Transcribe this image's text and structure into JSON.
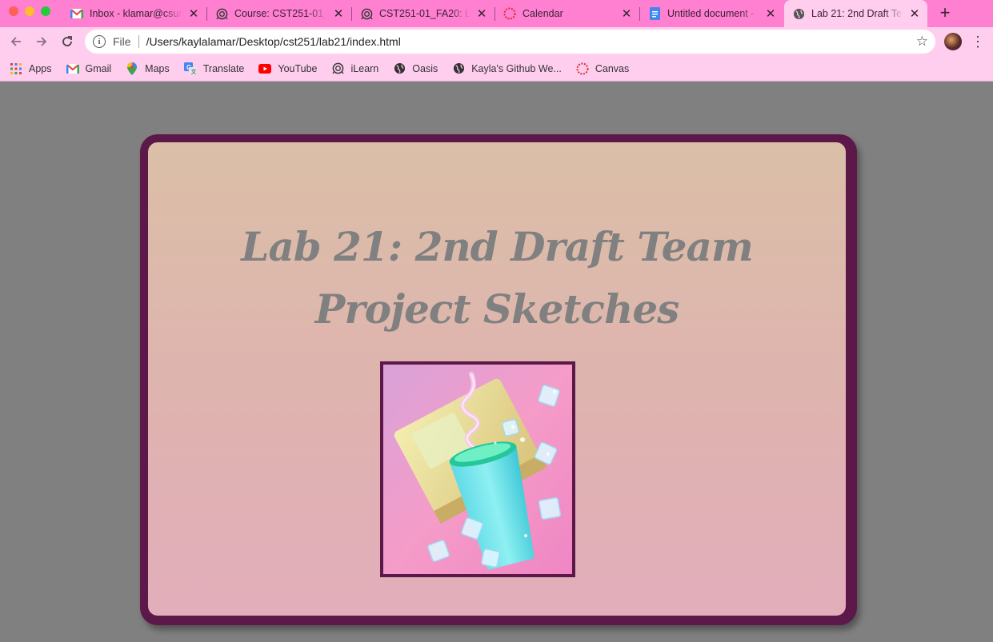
{
  "tabs": [
    {
      "title": "Inbox - klamar@csum",
      "icon": "gmail-icon",
      "active": false
    },
    {
      "title": "Course: CST251-01_",
      "icon": "ilearn-icon",
      "active": false
    },
    {
      "title": "CST251-01_FA20: La",
      "icon": "ilearn-icon",
      "active": false
    },
    {
      "title": "Calendar",
      "icon": "canvas-icon",
      "active": false
    },
    {
      "title": "Untitled document -",
      "icon": "docs-icon",
      "active": false
    },
    {
      "title": "Lab 21: 2nd Draft Te",
      "icon": "globe-icon",
      "active": true
    }
  ],
  "toolbar": {
    "scheme": "File",
    "url": "/Users/kaylalamar/Desktop/cst251/lab21/index.html"
  },
  "bookmarks": [
    {
      "label": "Apps",
      "icon": "apps-grid-icon"
    },
    {
      "label": "Gmail",
      "icon": "gmail-icon"
    },
    {
      "label": "Maps",
      "icon": "maps-pin-icon"
    },
    {
      "label": "Translate",
      "icon": "translate-icon"
    },
    {
      "label": "YouTube",
      "icon": "youtube-icon"
    },
    {
      "label": "iLearn",
      "icon": "ilearn-icon"
    },
    {
      "label": "Oasis",
      "icon": "globe-icon"
    },
    {
      "label": "Kayla's Github We...",
      "icon": "globe-icon"
    },
    {
      "label": "Canvas",
      "icon": "canvas-icon"
    }
  ],
  "page": {
    "heading_line1": "Lab 21: 2nd Draft Team",
    "heading_line2": "Project Sketches"
  },
  "colors": {
    "tab_strip": "#ff7fd1",
    "toolbar": "#ffcdee",
    "page_bg": "#808080",
    "card_border": "#5b1848",
    "heading": "#808080"
  }
}
